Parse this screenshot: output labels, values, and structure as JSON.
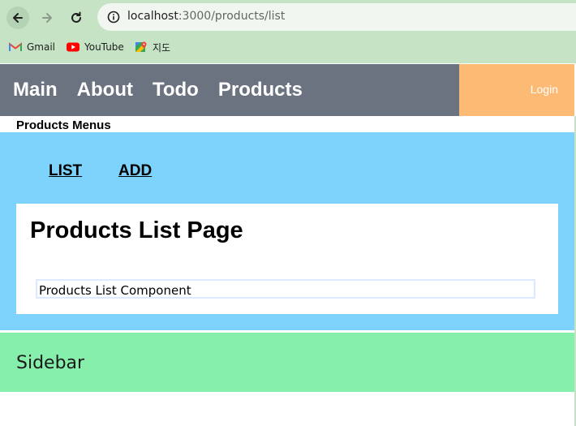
{
  "browser": {
    "url_host": "localhost",
    "url_path": ":3000/products/list",
    "bookmarks": [
      {
        "label": "Gmail",
        "icon": "gmail-icon"
      },
      {
        "label": "YouTube",
        "icon": "youtube-icon"
      },
      {
        "label": "지도",
        "icon": "maps-icon"
      }
    ]
  },
  "header": {
    "menu": [
      "Main",
      "About",
      "Todo",
      "Products"
    ],
    "login": "Login",
    "colors": {
      "bar": "#6b7280",
      "login_bg": "#fdba74"
    }
  },
  "products_menu": {
    "title": "Products Menus",
    "links": [
      "LIST",
      "ADD"
    ]
  },
  "content": {
    "title": "Products List Page",
    "component": "Products List Component"
  },
  "sidebar": {
    "label": "Sidebar"
  },
  "colors": {
    "chrome": "#c6e3c6",
    "blue_area": "#7dd3fc",
    "green_area": "#86efac"
  }
}
